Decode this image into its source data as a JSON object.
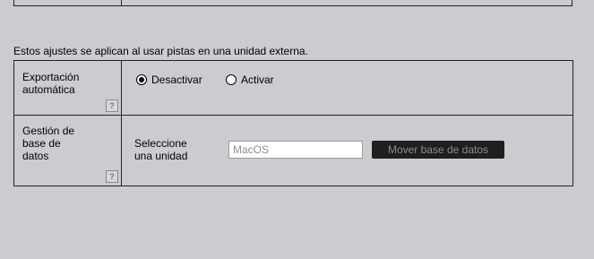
{
  "intro_text": "Estos ajustes se aplican al usar pistas en una unidad externa.",
  "auto_export": {
    "label": "Exportación automática",
    "help": "?",
    "options": [
      {
        "label": "Desactivar",
        "selected": true
      },
      {
        "label": "Activar",
        "selected": false
      }
    ]
  },
  "db_management": {
    "label": "Gestión de base de datos",
    "help": "?",
    "select_label": "Seleccione una unidad",
    "drive_value": "MacOS",
    "move_button": "Mover base de datos"
  }
}
